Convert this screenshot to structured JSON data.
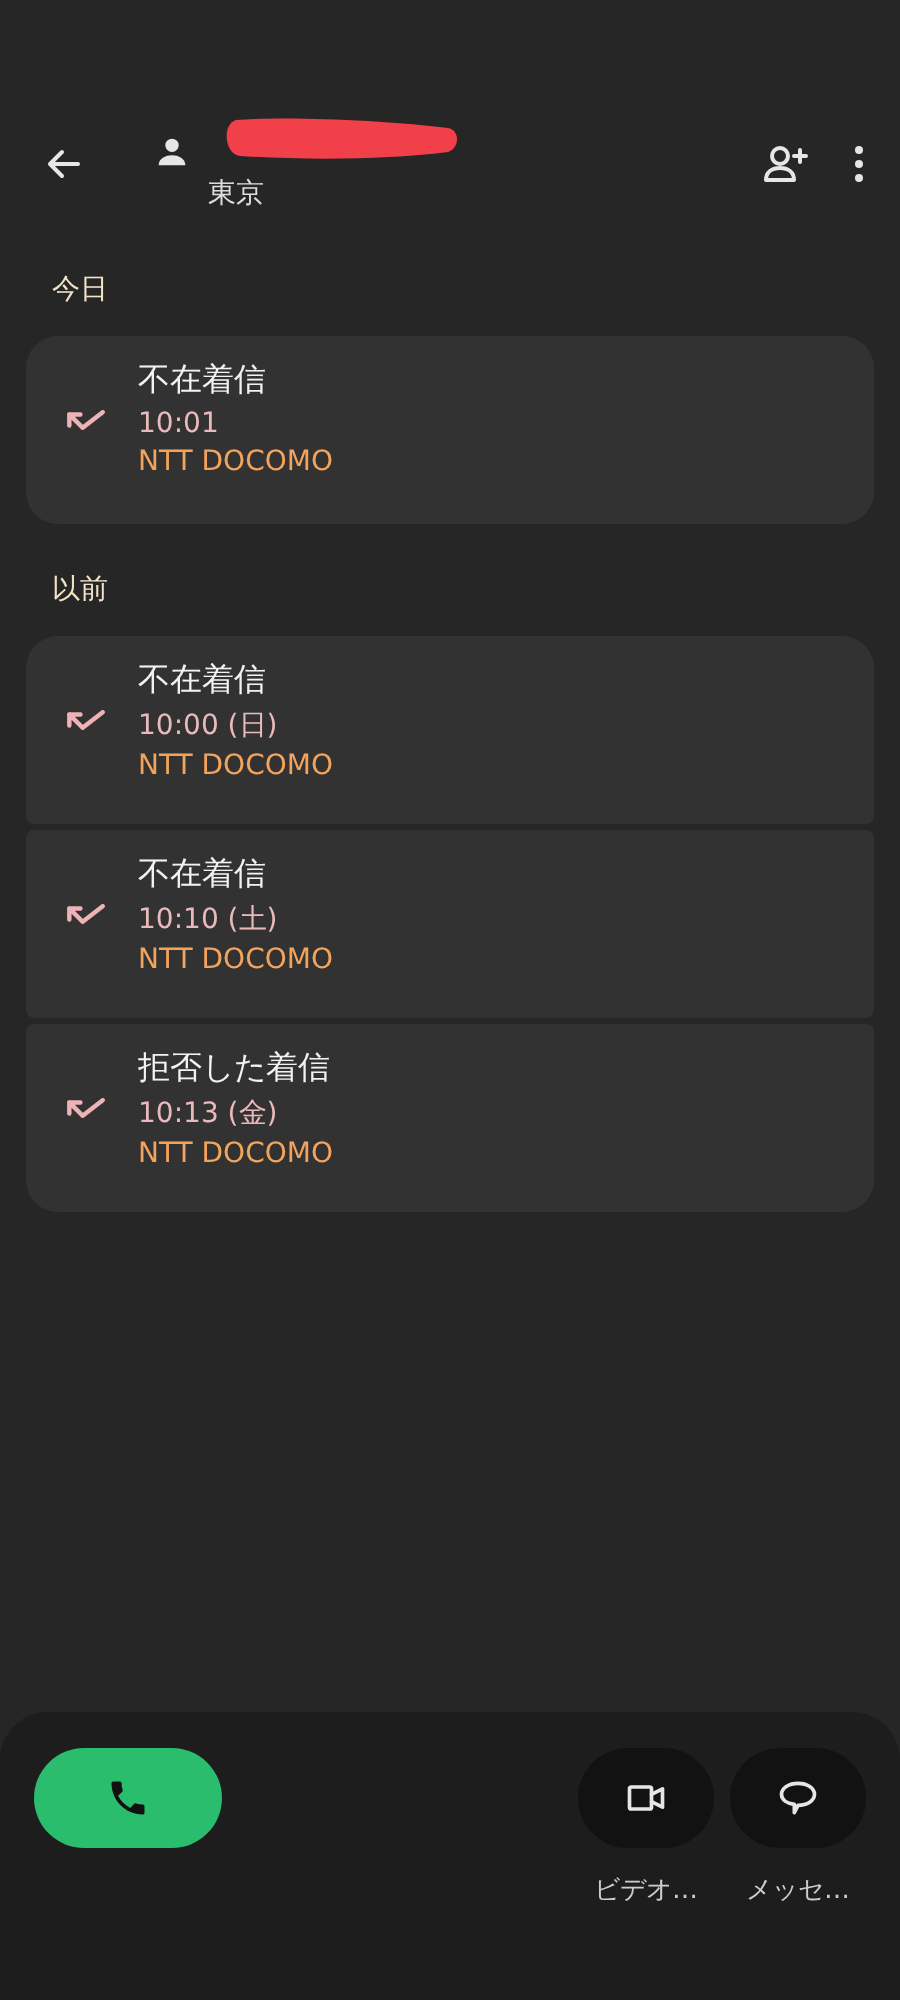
{
  "header": {
    "subtitle": "東京"
  },
  "sections": [
    {
      "label": "今日",
      "entries": [
        {
          "title": "不在着信",
          "time": "10:01",
          "carrier": "NTT DOCOMO"
        }
      ]
    },
    {
      "label": "以前",
      "entries": [
        {
          "title": "不在着信",
          "time": "10:00 (日)",
          "carrier": "NTT DOCOMO"
        },
        {
          "title": "不在着信",
          "time": "10:10 (土)",
          "carrier": "NTT DOCOMO"
        },
        {
          "title": "拒否した着信",
          "time": "10:13 (金)",
          "carrier": "NTT DOCOMO"
        }
      ]
    }
  ],
  "actions": [
    {
      "kind": "video",
      "label": "ビデオ…"
    },
    {
      "kind": "message",
      "label": "メッセ…"
    }
  ]
}
